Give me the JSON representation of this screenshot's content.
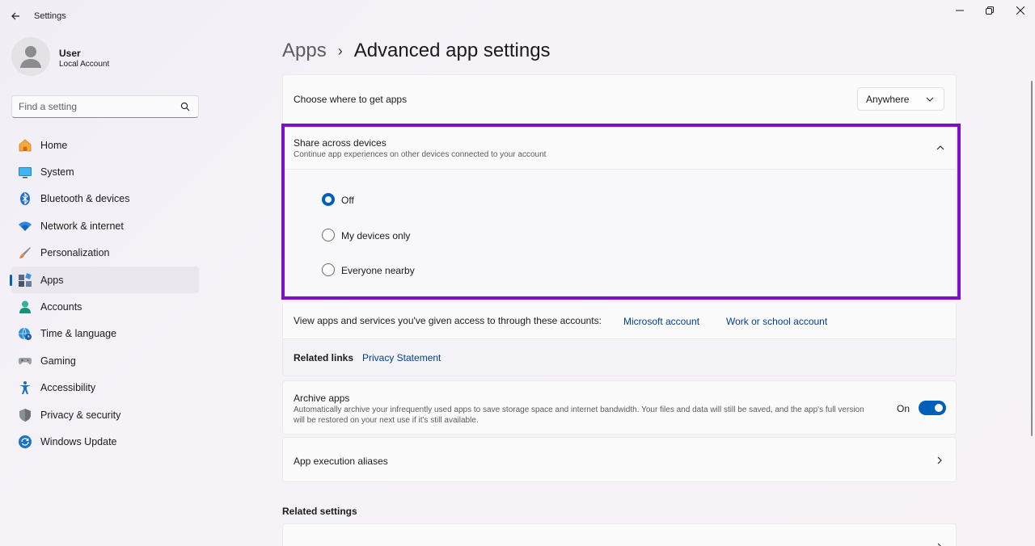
{
  "window": {
    "title": "Settings"
  },
  "user": {
    "name": "User",
    "account_type": "Local Account"
  },
  "search": {
    "placeholder": "Find a setting"
  },
  "sidebar": {
    "items": [
      {
        "label": "Home",
        "icon": "home-icon",
        "active": false
      },
      {
        "label": "System",
        "icon": "system-icon",
        "active": false
      },
      {
        "label": "Bluetooth & devices",
        "icon": "bluetooth-icon",
        "active": false
      },
      {
        "label": "Network & internet",
        "icon": "wifi-icon",
        "active": false
      },
      {
        "label": "Personalization",
        "icon": "brush-icon",
        "active": false
      },
      {
        "label": "Apps",
        "icon": "apps-icon",
        "active": true
      },
      {
        "label": "Accounts",
        "icon": "accounts-icon",
        "active": false
      },
      {
        "label": "Time & language",
        "icon": "globe-clock-icon",
        "active": false
      },
      {
        "label": "Gaming",
        "icon": "gamepad-icon",
        "active": false
      },
      {
        "label": "Accessibility",
        "icon": "accessibility-icon",
        "active": false
      },
      {
        "label": "Privacy & security",
        "icon": "shield-icon",
        "active": false
      },
      {
        "label": "Windows Update",
        "icon": "update-icon",
        "active": false
      }
    ]
  },
  "breadcrumb": {
    "parent": "Apps",
    "separator": "›",
    "current": "Advanced app settings"
  },
  "get_apps": {
    "label": "Choose where to get apps",
    "selected": "Anywhere"
  },
  "share": {
    "title": "Share across devices",
    "description": "Continue app experiences on other devices connected to your account",
    "options": [
      {
        "label": "Off",
        "checked": true
      },
      {
        "label": "My devices only",
        "checked": false
      },
      {
        "label": "Everyone nearby",
        "checked": false
      }
    ]
  },
  "accounts_access": {
    "label": "View apps and services you've given access to through these accounts:",
    "link_microsoft": "Microsoft account",
    "link_work": "Work or school account"
  },
  "related_links": {
    "label": "Related links",
    "privacy": "Privacy Statement"
  },
  "archive": {
    "title": "Archive apps",
    "description_line1": "Automatically archive your infrequently used apps to save storage space and internet bandwidth. Your files and data will still be saved, and the app's full version",
    "description_line2": "will be restored on your next use if it's still available.",
    "state_label": "On",
    "enabled": true
  },
  "aliases": {
    "label": "App execution aliases"
  },
  "related_settings": {
    "heading": "Related settings"
  },
  "colors": {
    "accent": "#005fb8",
    "highlight_border": "#7a10c8",
    "link": "#003e92"
  }
}
